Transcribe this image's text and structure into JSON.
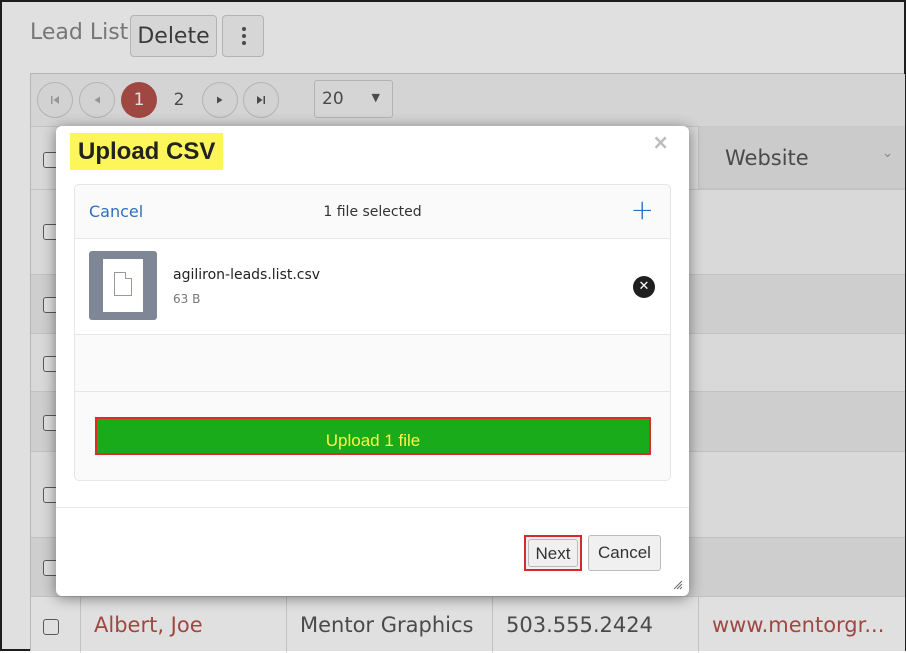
{
  "page": {
    "title": "Lead List",
    "delete_label": "Delete"
  },
  "pager": {
    "first_icon": "first-page-icon",
    "prev_icon": "prev-page-icon",
    "next_icon": "next-page-icon",
    "last_icon": "last-page-icon",
    "pages": [
      "1",
      "2"
    ],
    "current_page": "1",
    "page_size": "20"
  },
  "grid": {
    "visible_header": "Website",
    "last_row": {
      "name": "Albert, Joe",
      "company": "Mentor Graphics",
      "phone": "503.555.2424",
      "website": "www.mentorgr..."
    }
  },
  "modal": {
    "title": "Upload CSV",
    "close_glyph": "×",
    "uploader": {
      "cancel_label": "Cancel",
      "status": "1 file selected",
      "add_glyph": "+",
      "file": {
        "name": "agiliron-leads.list.csv",
        "size": "63 B",
        "remove_glyph": "✕"
      },
      "upload_button": "Upload 1 file"
    },
    "footer": {
      "next_label": "Next",
      "cancel_label": "Cancel"
    }
  },
  "colors": {
    "title_highlight": "#fdf65a",
    "upload_button_bg": "#1aab1a",
    "upload_button_text": "#fff24a",
    "annotation_border": "#dd2b2b",
    "link_blue": "#2f6fbf",
    "active_page": "#b5524a"
  }
}
